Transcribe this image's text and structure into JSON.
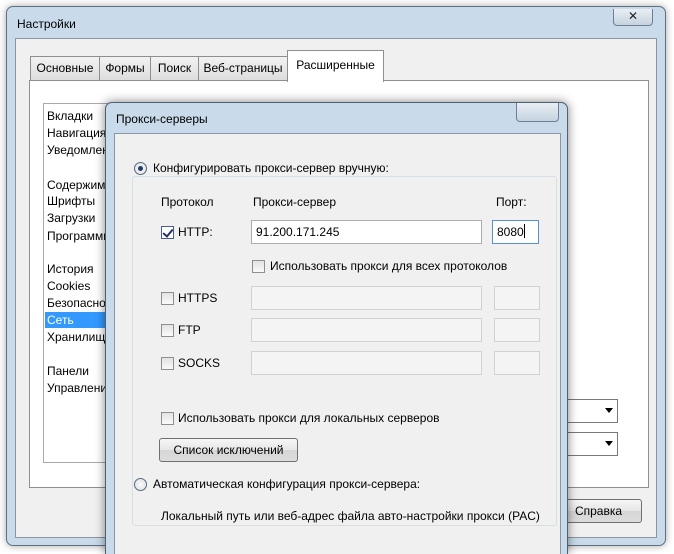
{
  "settings_window": {
    "title": "Настройки",
    "close_symbol": "✕",
    "tabs": [
      {
        "label": "Основные"
      },
      {
        "label": "Формы"
      },
      {
        "label": "Поиск"
      },
      {
        "label": "Веб-страницы"
      },
      {
        "label": "Расширенные",
        "active": true
      }
    ],
    "categories": [
      {
        "label": "Вкладки"
      },
      {
        "label": "Навигация"
      },
      {
        "label": "Уведомления"
      },
      {
        "label": "Содержимое"
      },
      {
        "label": "Шрифты"
      },
      {
        "label": "Загрузки"
      },
      {
        "label": "Программы"
      },
      {
        "label": "История"
      },
      {
        "label": "Cookies"
      },
      {
        "label": "Безопасность"
      },
      {
        "label": "Сеть",
        "selected": true
      },
      {
        "label": "Хранилище"
      },
      {
        "label": "Панели"
      },
      {
        "label": "Управление"
      }
    ],
    "help_button": "Справка"
  },
  "proxy_dialog": {
    "title": "Прокси-серверы",
    "manual_radio_label": "Конфигурировать прокси-сервер вручную:",
    "manual_selected": true,
    "col_protocol": "Протокол",
    "col_server": "Прокси-сервер",
    "col_port": "Порт:",
    "rows": [
      {
        "label": "HTTP:",
        "checked": true,
        "server": "91.200.171.245",
        "port": "8080",
        "enabled": true
      },
      {
        "label": "HTTPS",
        "checked": false,
        "server": "",
        "port": "",
        "enabled": false
      },
      {
        "label": "FTP",
        "checked": false,
        "server": "",
        "port": "",
        "enabled": false
      },
      {
        "label": "SOCKS",
        "checked": false,
        "server": "",
        "port": "",
        "enabled": false
      }
    ],
    "use_for_all_label": "Использовать прокси для всех протоколов",
    "use_for_all_checked": false,
    "local_servers_label": "Использовать прокси для локальных серверов",
    "local_servers_checked": false,
    "exceptions_button": "Список исключений",
    "auto_radio_label": "Автоматическая конфигурация прокси-сервера:",
    "auto_selected": false,
    "pac_label": "Локальный путь или веб-адрес файла авто-настройки прокси (PAC)"
  }
}
